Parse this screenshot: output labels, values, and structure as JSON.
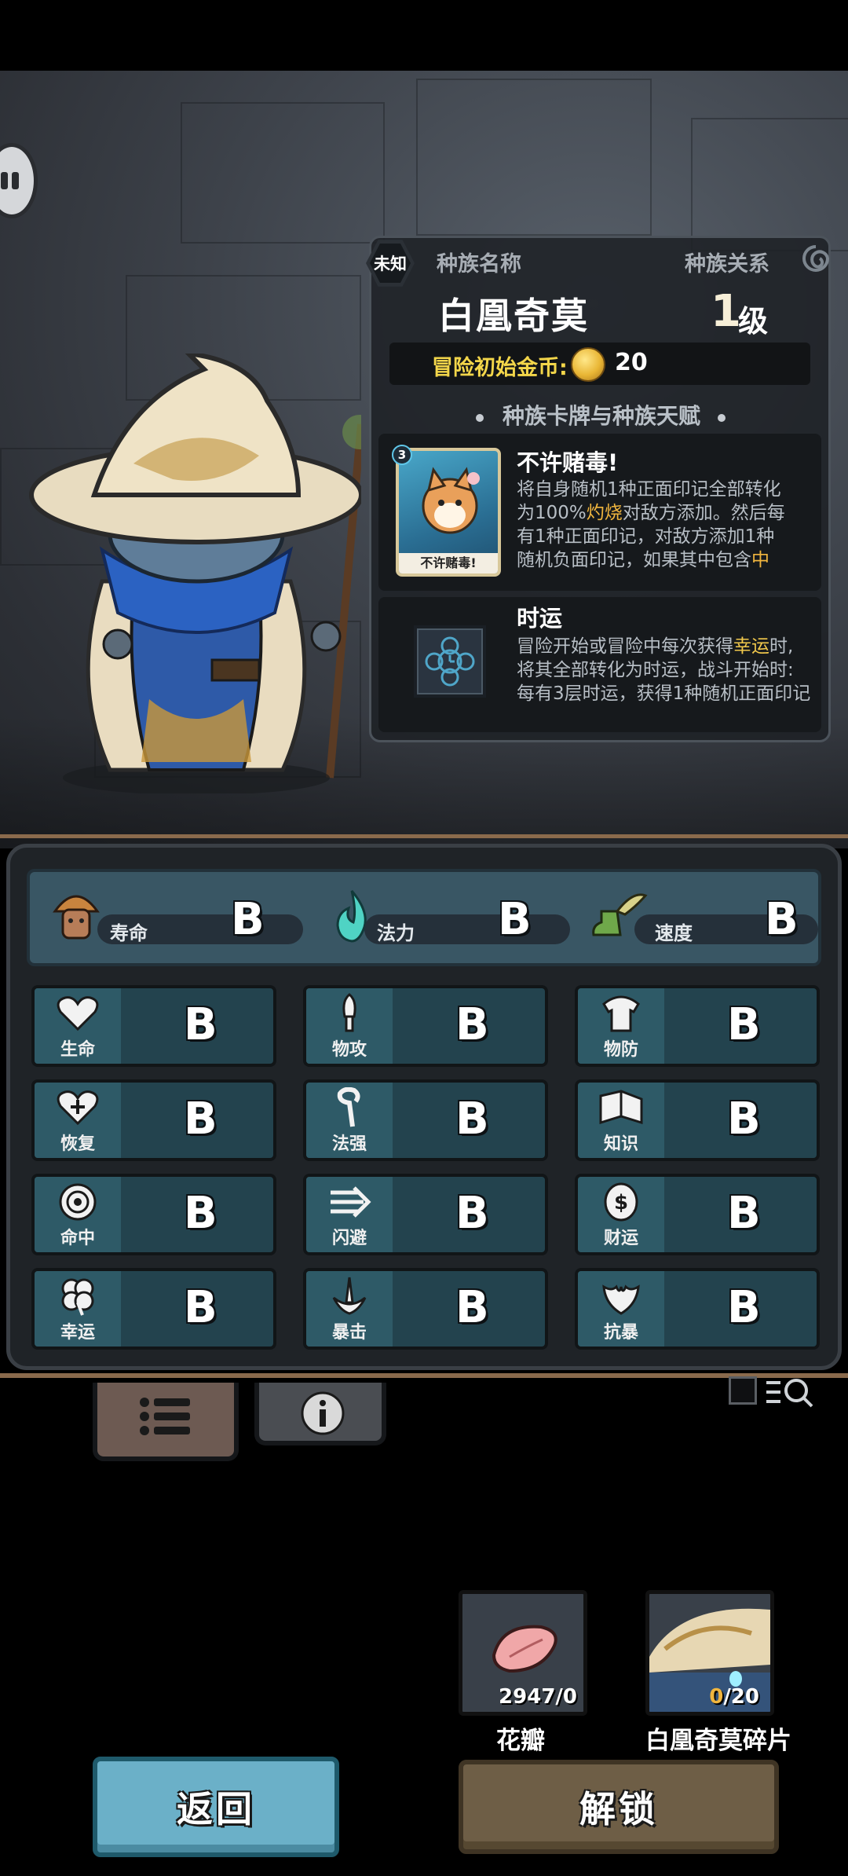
{
  "race_panel": {
    "unknown_badge": "未知",
    "race_name_label": "种族名称",
    "race_relation_label": "种族关系",
    "race_name": "白凰奇莫",
    "level_number": "1",
    "level_unit": "级",
    "start_coin_label": "冒险初始金币:",
    "start_coin_value": "20",
    "section_title": "种族卡牌与种族天赋",
    "card": {
      "cost": "3",
      "thumb_caption": "不许赌毒!",
      "title": "不许赌毒!",
      "desc_1": "将自身随机1种正面印记全部转化",
      "desc_2a": "为100%",
      "desc_2b": "灼烧",
      "desc_2c": "对敌方添加。然后每",
      "desc_3": "有1种正面印记，对敌方添加1种",
      "desc_4a": "随机负面印记，如果其中包含",
      "desc_4b": "中"
    },
    "talent": {
      "title": "时运",
      "desc_1a": "冒险开始或冒险中每次获得",
      "desc_1b": "幸运",
      "desc_1c": "时,",
      "desc_2": "将其全部转化为时运，战斗开始时:",
      "desc_3": "每有3层时运，获得1种随机正面印记"
    }
  },
  "top_stats": [
    {
      "label": "寿命",
      "grade": "B",
      "icon": "mushroom-character-icon"
    },
    {
      "label": "法力",
      "grade": "B",
      "icon": "blue-flame-icon"
    },
    {
      "label": "速度",
      "grade": "B",
      "icon": "winged-boot-icon"
    }
  ],
  "stats": [
    {
      "label": "生命",
      "grade": "B",
      "icon": "heart-icon"
    },
    {
      "label": "物攻",
      "grade": "B",
      "icon": "sword-icon"
    },
    {
      "label": "物防",
      "grade": "B",
      "icon": "armor-icon"
    },
    {
      "label": "恢复",
      "grade": "B",
      "icon": "heart-plus-icon"
    },
    {
      "label": "法强",
      "grade": "B",
      "icon": "staff-icon"
    },
    {
      "label": "知识",
      "grade": "B",
      "icon": "book-icon"
    },
    {
      "label": "命中",
      "grade": "B",
      "icon": "target-icon"
    },
    {
      "label": "闪避",
      "grade": "B",
      "icon": "dodge-arrow-icon"
    },
    {
      "label": "财运",
      "grade": "B",
      "icon": "coin-icon"
    },
    {
      "label": "幸运",
      "grade": "B",
      "icon": "clover-icon"
    },
    {
      "label": "暴击",
      "grade": "B",
      "icon": "crit-sword-icon"
    },
    {
      "label": "抗暴",
      "grade": "B",
      "icon": "shield-burst-icon"
    }
  ],
  "items": [
    {
      "name": "花瓣",
      "count_a": "2947/0",
      "count_b": "",
      "icon": "petal-icon"
    },
    {
      "name": "白凰奇莫碎片",
      "count_a": "0",
      "count_b": "/20",
      "icon": "character-shard-icon"
    }
  ],
  "buttons": {
    "back": "返回",
    "unlock": "解锁"
  },
  "colors": {
    "accent_orange": "#f0b53e",
    "button_back": "#6bb0c8",
    "button_unlock": "#6e5e46",
    "stat_cell": "#23434e"
  }
}
